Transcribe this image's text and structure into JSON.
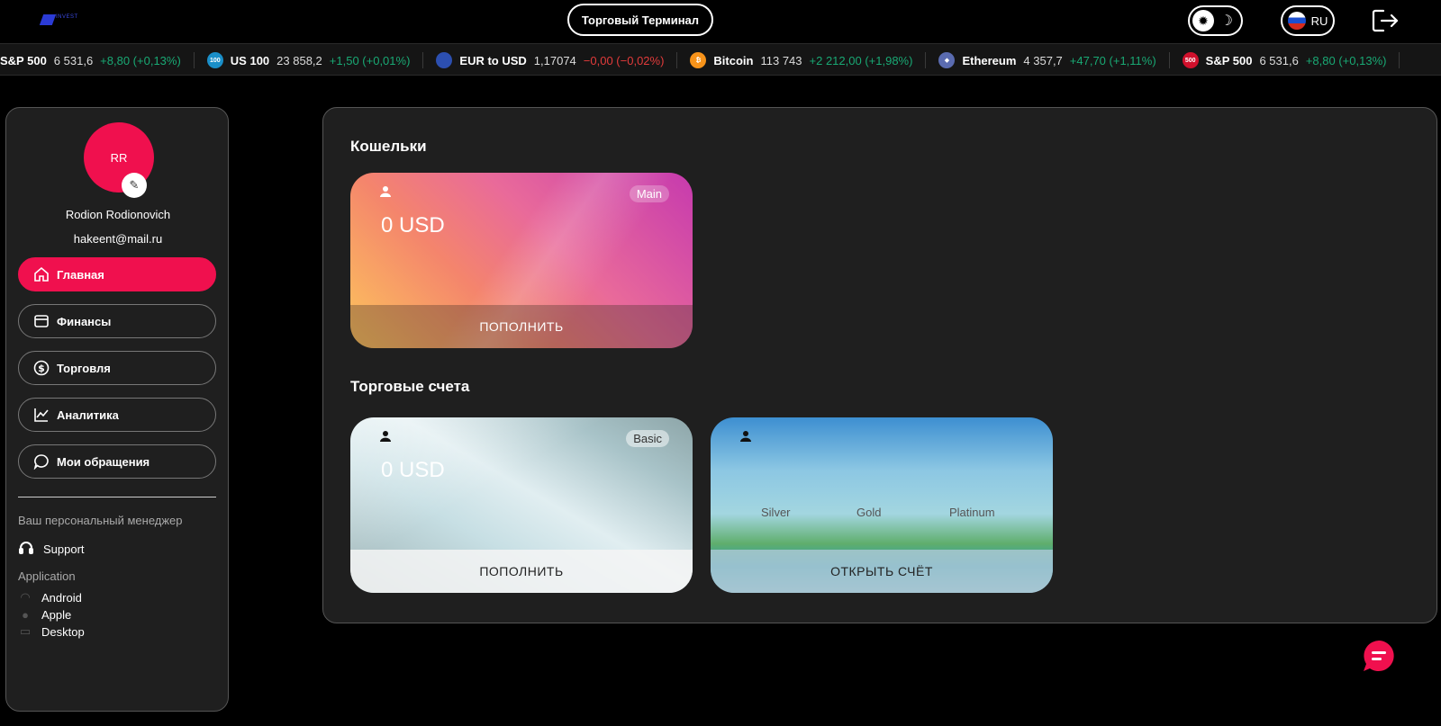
{
  "header": {
    "logo_text": "INVEST",
    "terminal_button": "Торговый Терминал",
    "language": "RU"
  },
  "ticker": [
    {
      "name": "S&P 500",
      "price": "6 531,6",
      "change": "+8,80 (+0,13%)",
      "dir": "up",
      "icon": "",
      "color": "#d0102c"
    },
    {
      "name": "US 100",
      "price": "23 858,2",
      "change": "+1,50 (+0,01%)",
      "dir": "up",
      "icon": "100",
      "color": "#1a8fc9"
    },
    {
      "name": "EUR to USD",
      "price": "1,17074",
      "change": "−0,00 (−0,02%)",
      "dir": "down",
      "icon": "",
      "color": "#2c4fb0"
    },
    {
      "name": "Bitcoin",
      "price": "113 743",
      "change": "+2 212,00 (+1,98%)",
      "dir": "up",
      "icon": "₿",
      "color": "#f7931a"
    },
    {
      "name": "Ethereum",
      "price": "4 357,7",
      "change": "+47,70 (+1,11%)",
      "dir": "up",
      "icon": "◆",
      "color": "#5a6bb0"
    },
    {
      "name": "S&P 500",
      "price": "6 531,6",
      "change": "+8,80 (+0,13%)",
      "dir": "up",
      "icon": "500",
      "color": "#d0102c"
    }
  ],
  "profile": {
    "initials": "RR",
    "name": "Rodion Rodionovich",
    "email": "hakeent@mail.ru"
  },
  "nav": [
    {
      "label": "Главная",
      "icon": "home-icon",
      "active": true
    },
    {
      "label": "Финансы",
      "icon": "wallet-icon",
      "active": false
    },
    {
      "label": "Торговля",
      "icon": "dollar-icon",
      "active": false
    },
    {
      "label": "Аналитика",
      "icon": "chart-icon",
      "active": false
    },
    {
      "label": "Мои обращения",
      "icon": "chat-bubble-icon",
      "active": false
    }
  ],
  "manager": {
    "label": "Ваш персональный менеджер",
    "support": "Support"
  },
  "apps": {
    "label": "Application",
    "items": [
      "Android",
      "Apple",
      "Desktop"
    ]
  },
  "wallets": {
    "title": "Кошельки",
    "main_card": {
      "badge": "Main",
      "amount": "0 USD",
      "cta": "ПОПОЛНИТЬ"
    }
  },
  "trading": {
    "title": "Торговые счета",
    "basic_card": {
      "badge": "Basic",
      "amount": "0 USD",
      "cta": "ПОПОЛНИТЬ"
    },
    "open_card": {
      "tiers": [
        "Silver",
        "Gold",
        "Platinum"
      ],
      "cta": "ОТКРЫТЬ СЧЁТ"
    }
  },
  "colors": {
    "accent": "#f0104e",
    "background": "#000000",
    "panel": "#1f1f1f"
  }
}
